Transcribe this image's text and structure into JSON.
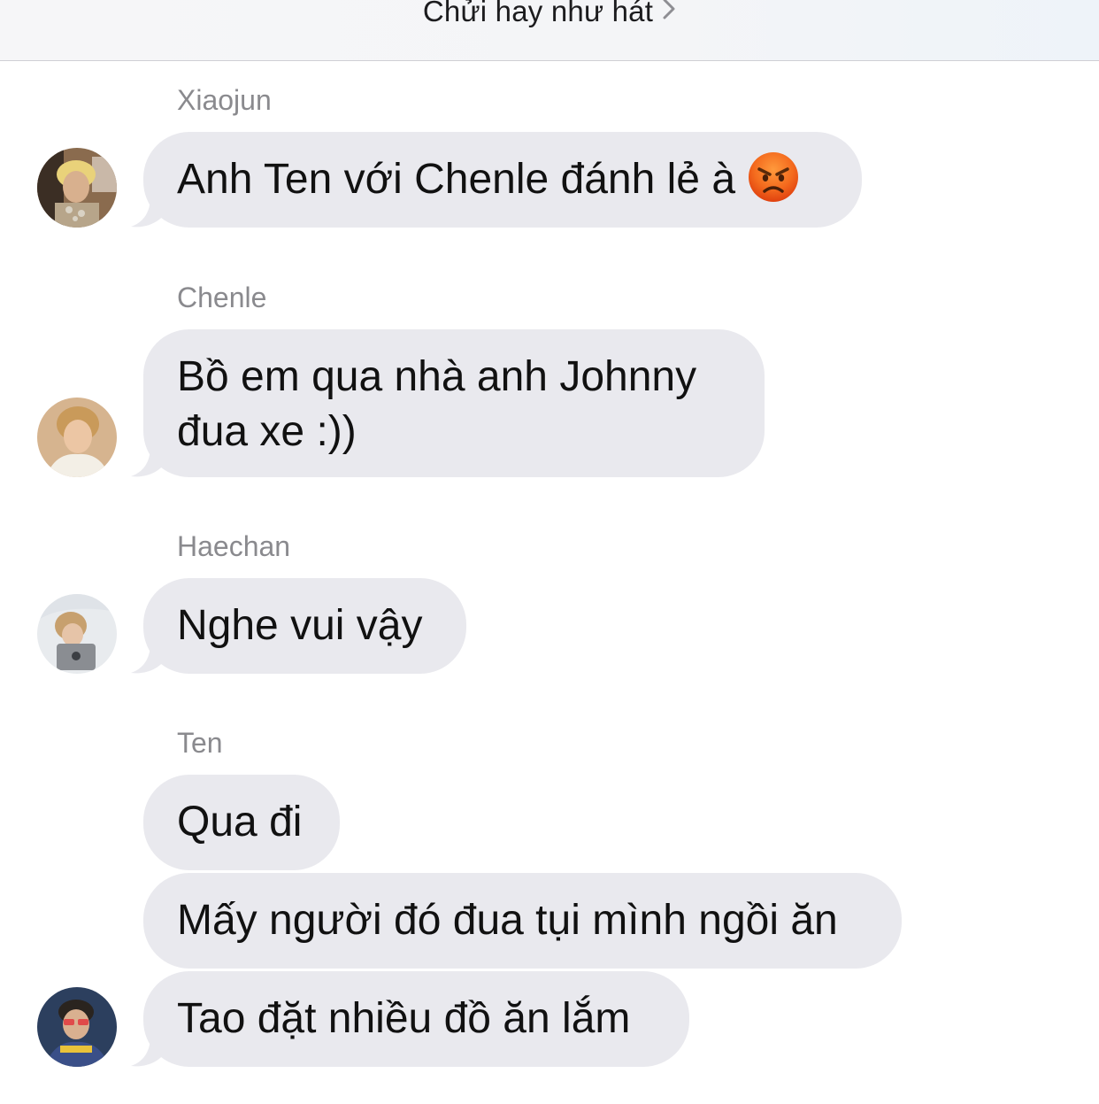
{
  "header": {
    "title": "Chửi hay như hát"
  },
  "messages": [
    {
      "sender": "Xiaojun",
      "lines": [
        "Anh Ten với Chenle đánh lẻ à"
      ],
      "emoji": "angry-face-icon"
    },
    {
      "sender": "Chenle",
      "lines": [
        "Bồ em qua nhà anh Johnny",
        "đua xe :))"
      ]
    },
    {
      "sender": "Haechan",
      "lines": [
        "Nghe vui vậy"
      ]
    },
    {
      "sender": "Ten",
      "lines": [
        "Qua đi",
        "Mấy người đó đua tụi mình ngồi ăn",
        "Tao đặt nhiều đồ ăn lắm"
      ]
    }
  ],
  "colors": {
    "bubble": "#e9e9ee",
    "sender_name": "#8a8a8e",
    "text": "#111111"
  }
}
